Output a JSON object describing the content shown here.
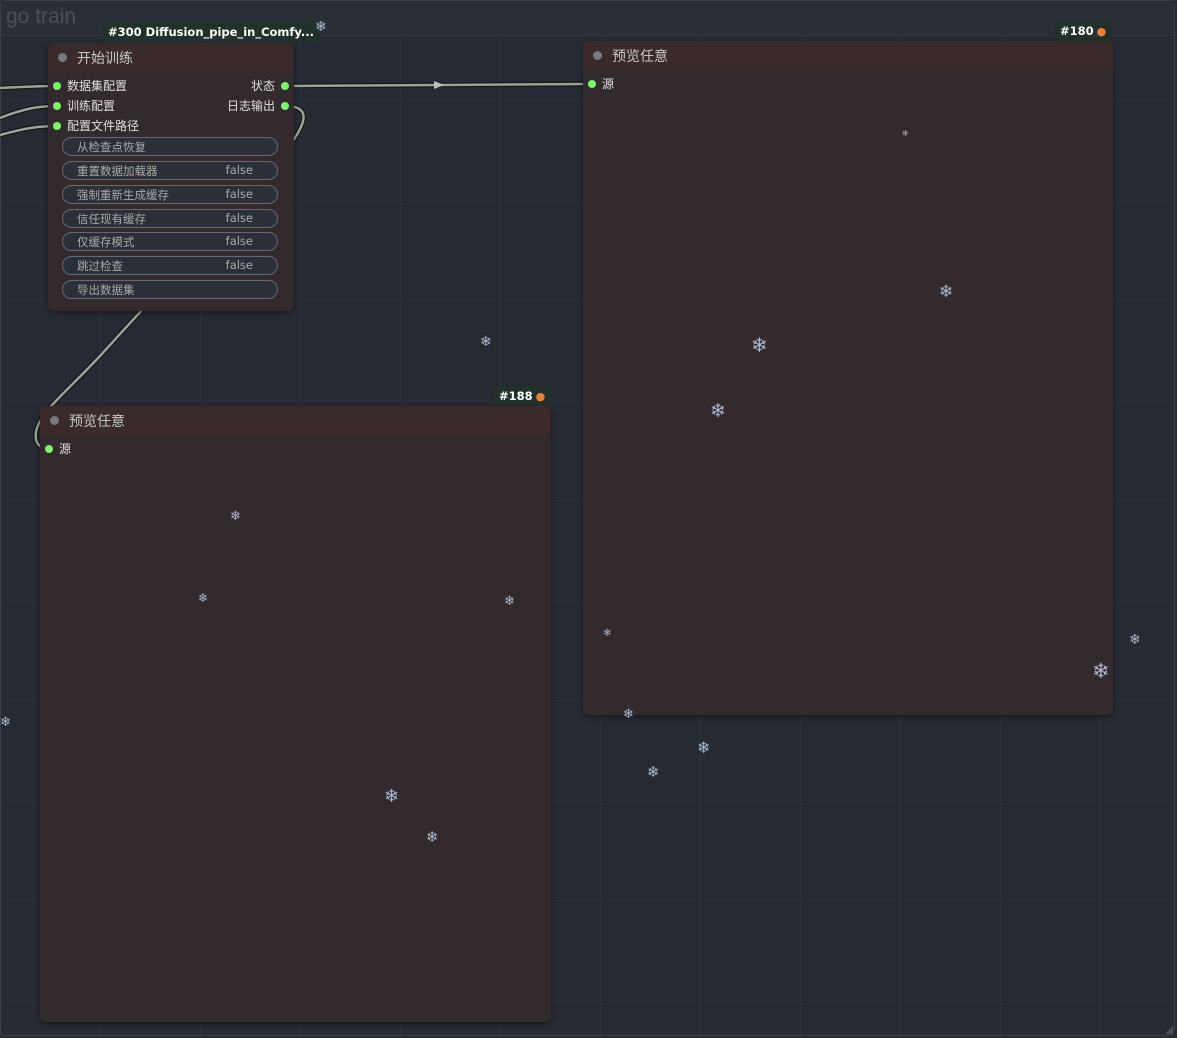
{
  "canvas": {
    "group_title": "go train"
  },
  "nodes": {
    "train": {
      "badge": "#300 Diffusion_pipe_in_Comfy...",
      "title": "开始训练",
      "inputs": [
        "数据集配置",
        "训练配置",
        "配置文件路径"
      ],
      "outputs": [
        "状态",
        "日志输出"
      ],
      "widgets": [
        {
          "label": "从检查点恢复",
          "value": ""
        },
        {
          "label": "重置数据加载器",
          "value": "false"
        },
        {
          "label": "强制重新生成缓存",
          "value": "false"
        },
        {
          "label": "信任现有缓存",
          "value": "false"
        },
        {
          "label": "仅缓存模式",
          "value": "false"
        },
        {
          "label": "跳过检查",
          "value": "false"
        },
        {
          "label": "导出数据集",
          "value": ""
        }
      ]
    },
    "preview_180": {
      "badge": "#180",
      "badge_icon": "fox-icon",
      "title": "预览任意",
      "input": "源"
    },
    "preview_188": {
      "badge": "#188",
      "badge_icon": "fox-icon",
      "title": "预览任意",
      "input": "源"
    }
  },
  "decor": {
    "snowflake_glyph": "❄",
    "snowflake_color": "#a9bad0"
  },
  "colors": {
    "canvas_bg": "#262a33",
    "node_body": "#332a2e",
    "node_header": "#3a2a2a",
    "slot_connected": "#7cf56a",
    "link_color": "#9aa59a"
  }
}
